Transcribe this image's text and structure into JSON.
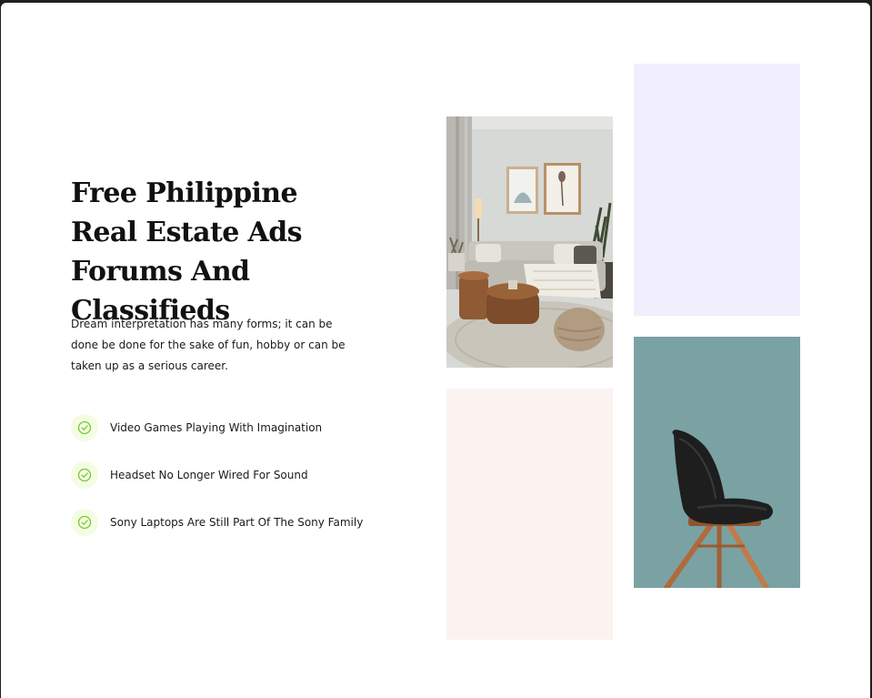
{
  "hero": {
    "heading": "Free Philippine Real Estate Ads Forums And Classifieds",
    "description": "Dream interpretation has many forms; it can be done be done for the sake of fun, hobby or can be taken up as a serious career.",
    "features": [
      {
        "icon": "check-circle-icon",
        "label": "Video Games Playing With Imagination"
      },
      {
        "icon": "check-circle-icon",
        "label": "Headset No Longer Wired For Sound"
      },
      {
        "icon": "check-circle-icon",
        "label": "Sony Laptops Are Still Part Of The Sony Family"
      }
    ]
  },
  "gallery": {
    "images": [
      {
        "name": "living-room-photo",
        "color": "#cfd2cf"
      },
      {
        "name": "lavender-placeholder",
        "color": "#f1eefd"
      },
      {
        "name": "pink-placeholder",
        "color": "#fcf3f0"
      },
      {
        "name": "chair-photo",
        "color": "#7aa2a3"
      }
    ]
  },
  "colors": {
    "accent_green": "#7cc72a",
    "check_bg": "#f3fde3",
    "heading": "#111111",
    "text": "#1a1a1a"
  }
}
